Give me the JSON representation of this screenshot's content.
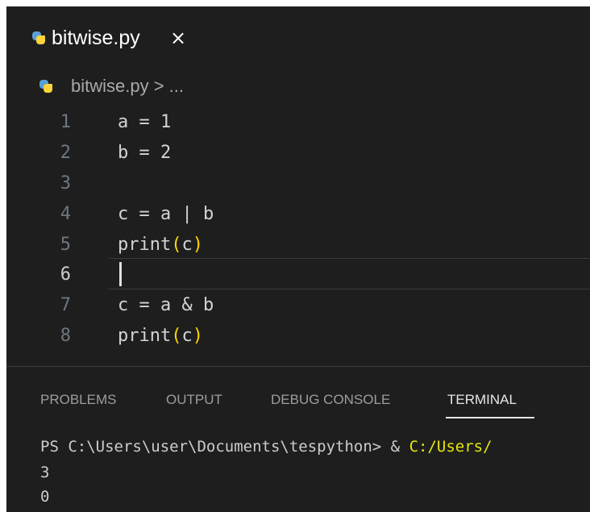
{
  "editor_tab": {
    "filename": "bitwise.py",
    "close_glyph": "×",
    "icon": "python-file-icon"
  },
  "breadcrumb": {
    "icon": "python-file-icon",
    "text": "bitwise.py > ..."
  },
  "editor": {
    "current_line": 6,
    "lines": [
      {
        "number": "1",
        "code": "a = 1"
      },
      {
        "number": "2",
        "code": "b = 2"
      },
      {
        "number": "3",
        "code": ""
      },
      {
        "number": "4",
        "code": "c = a | b"
      },
      {
        "number": "5",
        "code_pre": "print",
        "code_paren_open": "(",
        "code_arg": "c",
        "code_paren_close": ")"
      },
      {
        "number": "6",
        "code": ""
      },
      {
        "number": "7",
        "code": "c = a & b"
      },
      {
        "number": "8",
        "code_pre": "print",
        "code_paren_open": "(",
        "code_arg": "c",
        "code_paren_close": ")"
      }
    ]
  },
  "panel": {
    "tabs": [
      "PROBLEMS",
      "OUTPUT",
      "DEBUG CONSOLE",
      "TERMINAL"
    ],
    "active_tab": "TERMINAL",
    "terminal": {
      "prompt": "PS C:\\Users\\user\\Documents\\tespython> & ",
      "command_path": "C:/Users/",
      "output": [
        "3",
        "0"
      ]
    }
  },
  "colors": {
    "background": "#1e1e1e",
    "paren": "#ffd700",
    "terminal_path": "#e5e510"
  }
}
